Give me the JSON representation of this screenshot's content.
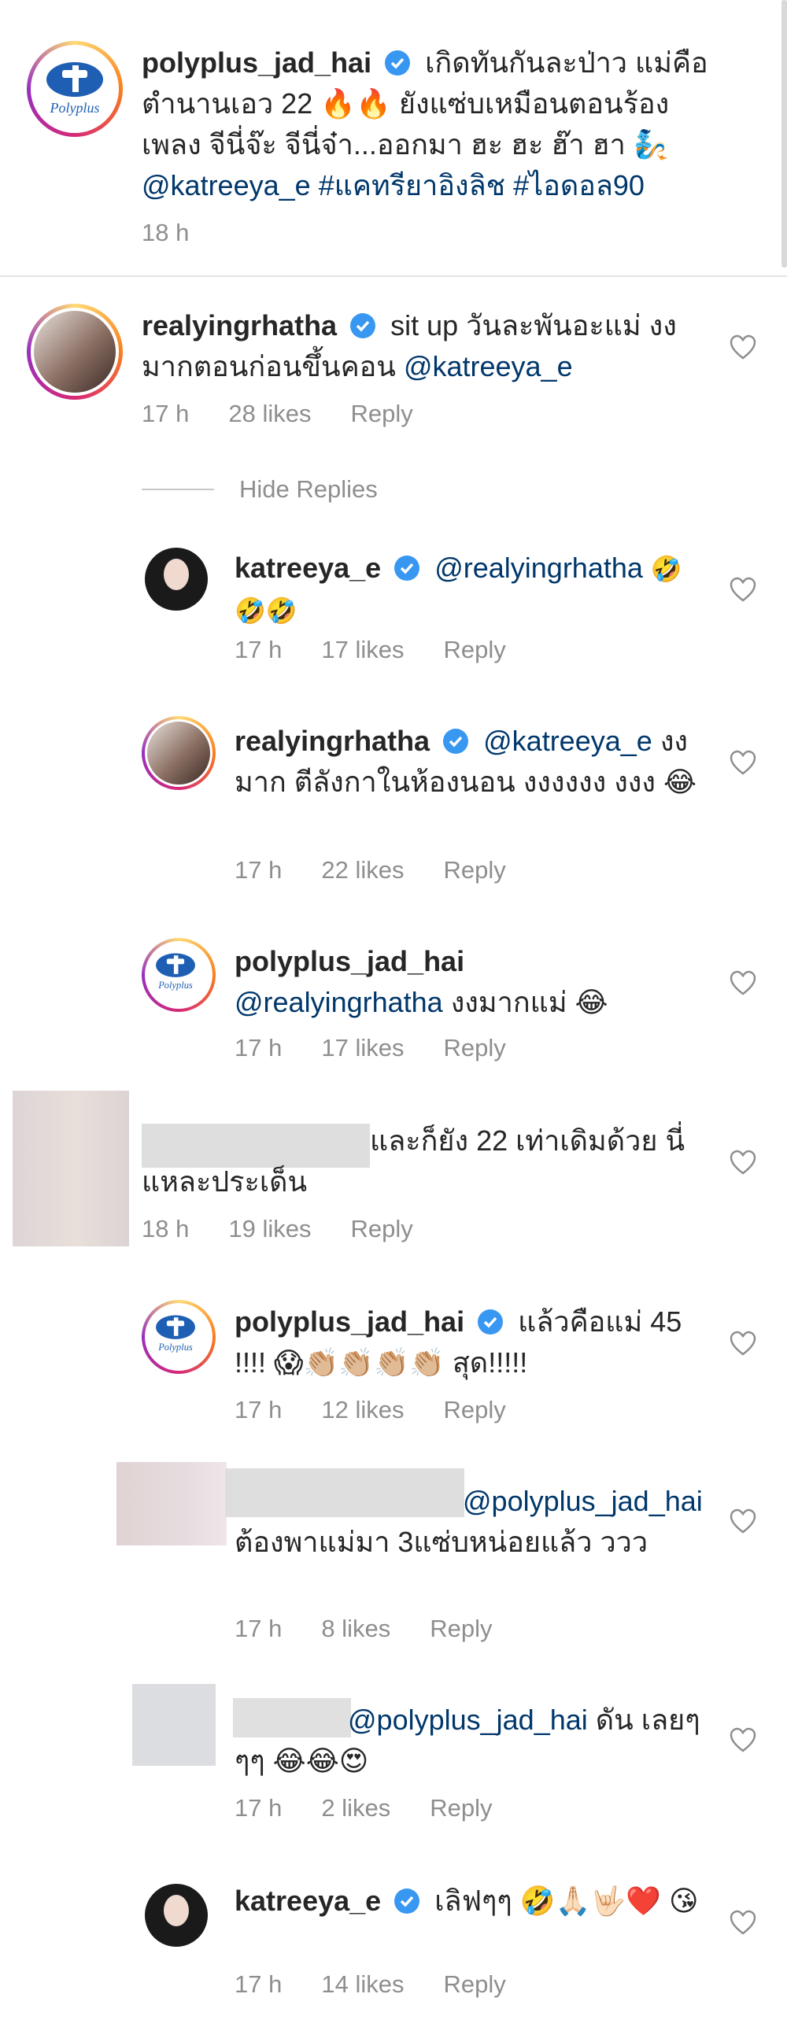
{
  "comments": [
    {
      "user": "polyplus_jad_hai",
      "text": "เกิดทันกันละป่าว แม่คือ ตำนานเอว 22 🔥🔥 ยังแซ่บเหมือนตอนร้อง เพลง จีนี่จ๊ะ จีนี่จ๋า...ออกมา ฮะ ฮะ ฮ๊า ฮา 🧞",
      "mention": "@katreeya_e",
      "tags": "#แคทรียาอิงลิช #ไอดอล90",
      "time": "18 h"
    },
    {
      "user": "realyingrhatha",
      "text": "sit up วันละพันอะแม่ งง มากตอนก่อนขึ้นคอน",
      "mention": "@katreeya_e",
      "time": "17 h",
      "likes": "28 likes",
      "reply": "Reply"
    },
    {
      "user": "katreeya_e",
      "mention": "@realyingrhatha",
      "text": "🤣🤣🤣",
      "time": "17 h",
      "likes": "17 likes",
      "reply": "Reply"
    },
    {
      "user": "realyingrhatha",
      "mention": "@katreeya_e",
      "text": "งงมาก ตีลังกาในห้องนอน งงงงงง งงง 😂",
      "time": "17 h",
      "likes": "22 likes",
      "reply": "Reply"
    },
    {
      "user": "polyplus_jad_hai",
      "mention": "@realyingrhatha",
      "text": "งงมากแม่ 😂",
      "time": "17 h",
      "likes": "17 likes",
      "reply": "Reply"
    },
    {
      "text": "และก็ยัง 22 เท่าเดิมด้วย นี่แหละประเด็น",
      "time": "18 h",
      "likes": "19 likes",
      "reply": "Reply"
    },
    {
      "user": "polyplus_jad_hai",
      "text": "แล้วคือแม่ 45 !!!! 😱👏🏼👏🏼👏🏼👏🏼 สุด!!!!!",
      "time": "17 h",
      "likes": "12 likes",
      "reply": "Reply"
    },
    {
      "mention": "@polyplus_jad_hai",
      "text": "ต้องพาแม่มา 3แซ่บหน่อยแล้ว ววว",
      "time": "17 h",
      "likes": "8 likes",
      "reply": "Reply"
    },
    {
      "mention": "@polyplus_jad_hai",
      "text": "ดัน เลยๆๆๆ 😂😂😍",
      "time": "17 h",
      "likes": "2 likes",
      "reply": "Reply"
    },
    {
      "user": "katreeya_e",
      "text": "เลิฟๆๆ 🤣🙏🏻🤟🏻❤️ 😘",
      "time": "17 h",
      "likes": "14 likes",
      "reply": "Reply"
    }
  ],
  "hide_replies": "Hide Replies",
  "colors": {
    "link": "#00376b",
    "verified": "#3897f0",
    "meta": "#8e8e8e"
  },
  "icons": {
    "verified": "verified-badge-icon",
    "like": "heart-outline-icon"
  }
}
